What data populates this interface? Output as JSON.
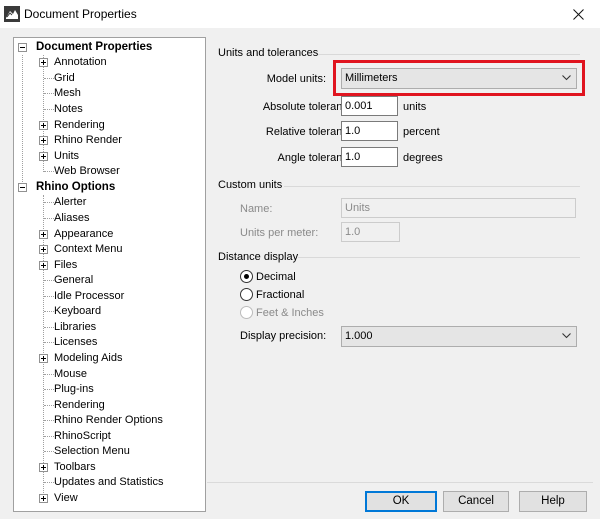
{
  "window": {
    "title": "Document Properties"
  },
  "tree": {
    "doc_properties": {
      "label": "Document Properties",
      "children": [
        "Annotation",
        "Grid",
        "Mesh",
        "Notes",
        "Rendering",
        "Rhino Render",
        "Units",
        "Web Browser"
      ]
    },
    "rhino_options": {
      "label": "Rhino Options",
      "children": [
        "Alerter",
        "Aliases",
        "Appearance",
        "Context Menu",
        "Files",
        "General",
        "Idle Processor",
        "Keyboard",
        "Libraries",
        "Licenses",
        "Modeling Aids",
        "Mouse",
        "Plug-ins",
        "Rendering",
        "Rhino Render Options",
        "RhinoScript",
        "Selection Menu",
        "Toolbars",
        "Updates and Statistics",
        "View"
      ]
    }
  },
  "units_tolerances": {
    "title": "Units and tolerances",
    "model_units_label": "Model units:",
    "model_units_value": "Millimeters",
    "abs_tol_label": "Absolute tolerance:",
    "abs_tol_value": "0.001",
    "abs_tol_unit": "units",
    "rel_tol_label": "Relative tolerance:",
    "rel_tol_value": "1.0",
    "rel_tol_unit": "percent",
    "angle_tol_label": "Angle tolerance:",
    "angle_tol_value": "1.0",
    "angle_tol_unit": "degrees"
  },
  "custom_units": {
    "title": "Custom units",
    "name_label": "Name:",
    "name_value": "Units",
    "upm_label": "Units per meter:",
    "upm_value": "1.0"
  },
  "distance_display": {
    "title": "Distance display",
    "decimal": "Decimal",
    "fractional": "Fractional",
    "feet_inches": "Feet & Inches",
    "precision_label": "Display precision:",
    "precision_value": "1.000"
  },
  "buttons": {
    "ok": "OK",
    "cancel": "Cancel",
    "help": "Help"
  },
  "colors": {
    "highlight": "#e0141f",
    "default_button_border": "#0078d7"
  }
}
